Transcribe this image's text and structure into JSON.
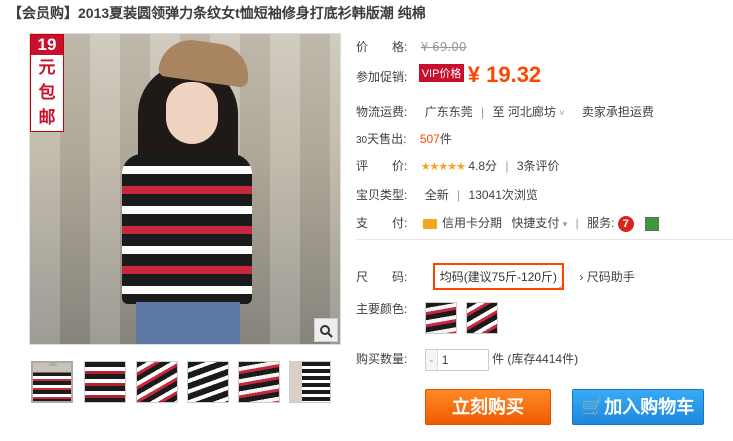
{
  "title": "【会员购】2013夏装圆领弹力条纹女t恤短袖修身打底衫韩版潮 纯棉",
  "promo_badge": {
    "num": "19",
    "line1": "元",
    "line2": "包",
    "line3": "邮"
  },
  "zoom_icon": "search-icon",
  "thumbnails": [
    "thumb-1",
    "thumb-2",
    "thumb-3",
    "thumb-4",
    "thumb-5",
    "thumb-6"
  ],
  "price": {
    "label": "价　　格:",
    "original": "¥ 69.00"
  },
  "promo": {
    "label": "参加促销:",
    "badge": "VIP价格",
    "price": "¥ 19.32"
  },
  "shipping": {
    "label": "物流运费:",
    "from": "广东东莞",
    "to_prefix": "至",
    "to": "河北廊坊",
    "fee": "卖家承担运费"
  },
  "sold": {
    "label_num": "30",
    "label_text": "天售出:",
    "count": "507",
    "unit": "件"
  },
  "rating": {
    "label": "评　　价:",
    "stars": "★★★★★",
    "score": "4.8分",
    "reviews": "3条评价"
  },
  "type": {
    "label": "宝贝类型:",
    "condition": "全新",
    "views": "13041次浏览"
  },
  "payment": {
    "label": "支　　付:",
    "credit": "信用卡分期",
    "quick": "快捷支付",
    "service_label": "服务:",
    "seven": "7"
  },
  "size": {
    "label": "尺　　码:",
    "value": "均码(建议75斤-120斤)",
    "help": "尺码助手"
  },
  "color": {
    "label": "主要颜色:"
  },
  "quantity": {
    "label": "购买数量:",
    "minus": "-",
    "value": "1",
    "unit": "件",
    "stock": "(库存4414件)"
  },
  "buttons": {
    "buy": "立刻购买",
    "cart": "加入购物车"
  }
}
